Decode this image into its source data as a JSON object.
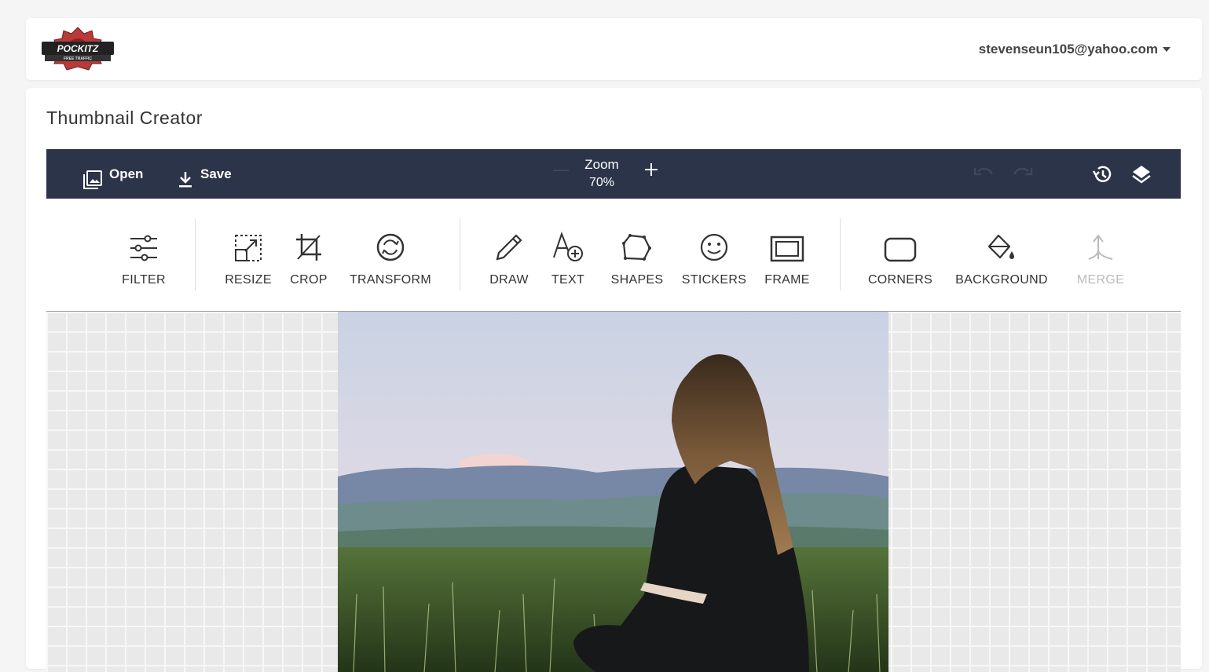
{
  "header": {
    "logo_text": "POCKITZ",
    "logo_subtext": "FREE TRAFFIC",
    "user_email": "stevenseun105@yahoo.com"
  },
  "page": {
    "title": "Thumbnail Creator"
  },
  "editor_bar": {
    "open_label": "Open",
    "save_label": "Save",
    "zoom_label": "Zoom",
    "zoom_value": "70%",
    "background_color": "#2b3448"
  },
  "tools": {
    "filter": "FILTER",
    "resize": "RESIZE",
    "crop": "CROP",
    "transform": "TRANSFORM",
    "draw": "DRAW",
    "text": "TEXT",
    "shapes": "SHAPES",
    "stickers": "STICKERS",
    "frame": "FRAME",
    "corners": "CORNERS",
    "background": "BACKGROUND",
    "merge": "MERGE"
  },
  "icons": {
    "open": "image-icon",
    "save": "download-icon",
    "undo": "undo-icon",
    "redo": "redo-icon",
    "history": "history-icon",
    "layers": "layers-icon"
  }
}
